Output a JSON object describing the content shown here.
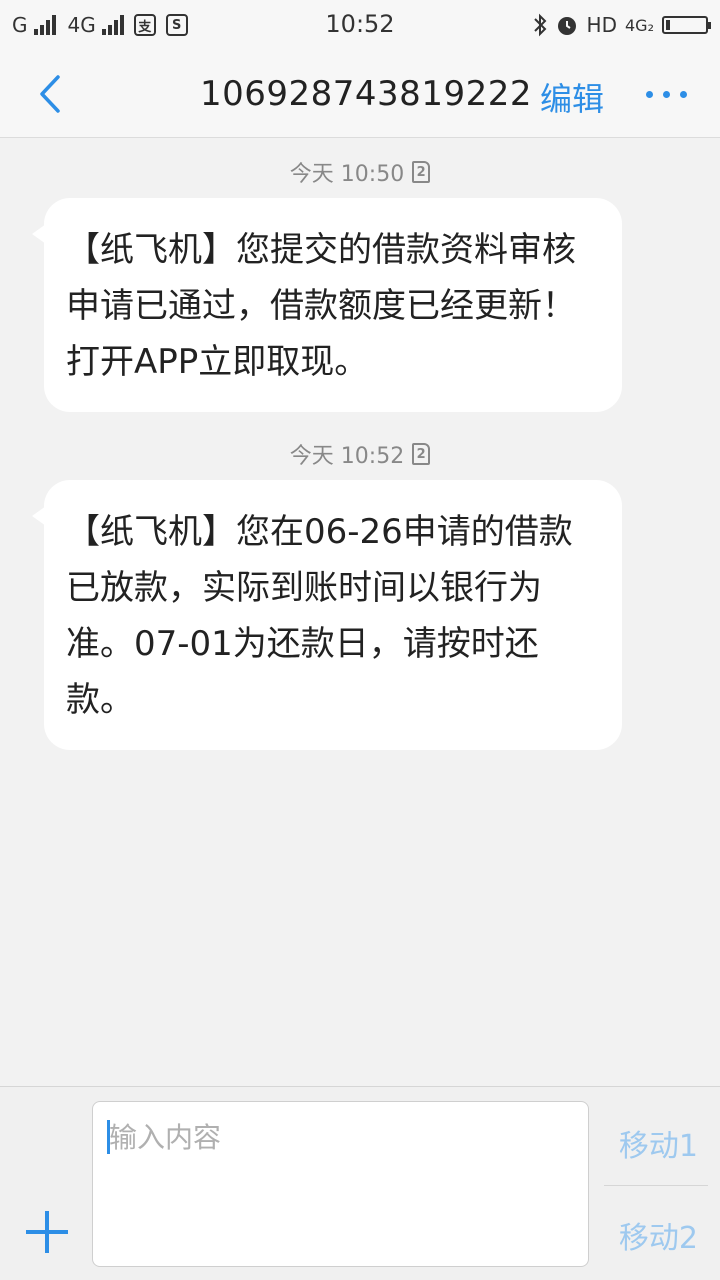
{
  "status_bar": {
    "carrier1": "G",
    "carrier2": "4G",
    "app_icon1": "支",
    "app_icon2": "S",
    "time": "10:52",
    "hd": "HD",
    "net": "4G₂"
  },
  "header": {
    "title": "106928743819222",
    "edit_label": "编辑"
  },
  "messages": [
    {
      "time": "今天 10:50",
      "sim": "2",
      "text": "【纸飞机】您提交的借款资料审核申请已通过，借款额度已经更新！打开APP立即取现。"
    },
    {
      "time": "今天 10:52",
      "sim": "2",
      "text": "【纸飞机】您在06-26申请的借款已放款，实际到账时间以银行为准。07-01为还款日，请按时还款。"
    }
  ],
  "composer": {
    "placeholder": "输入内容",
    "send_sim1": "移动1",
    "send_sim2": "移动2"
  },
  "colors": {
    "accent": "#2d8ee6",
    "background": "#f2f2f2",
    "bubble": "#ffffff"
  }
}
